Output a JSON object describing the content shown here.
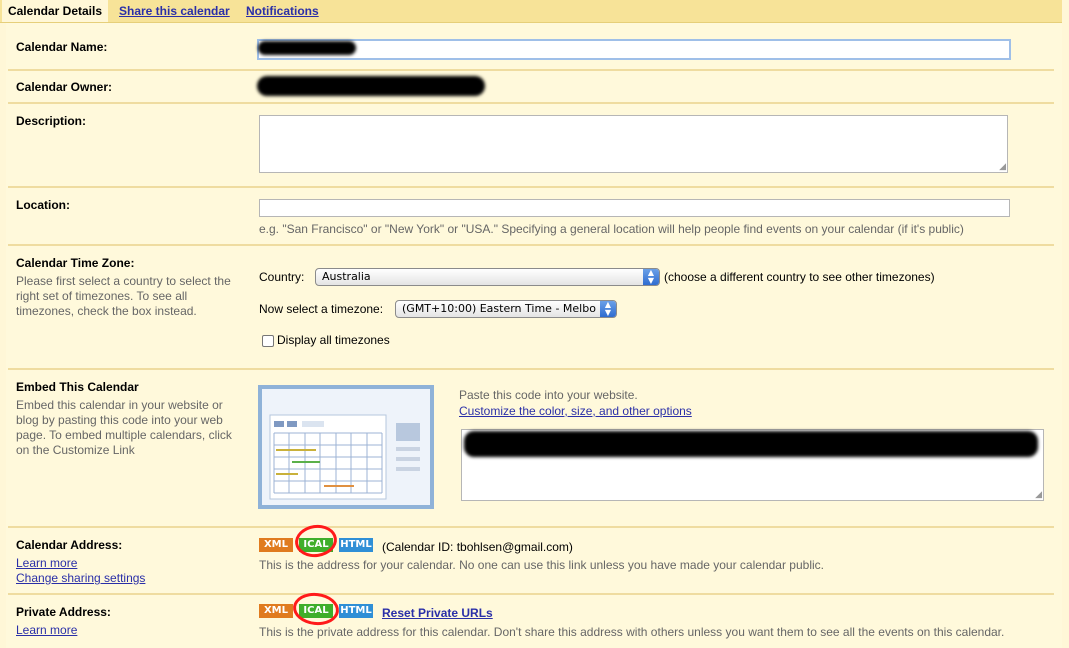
{
  "tabs": {
    "details": "Calendar Details",
    "share": "Share this calendar",
    "notifications": "Notifications"
  },
  "name": {
    "label": "Calendar Name:"
  },
  "owner": {
    "label": "Calendar Owner:"
  },
  "description": {
    "label": "Description:"
  },
  "location": {
    "label": "Location:",
    "hint": "e.g. \"San Francisco\" or \"New York\" or \"USA.\" Specifying a general location will help people find events on your calendar (if it's public)"
  },
  "timezone": {
    "label": "Calendar Time Zone:",
    "help": "Please first select a country to select the right set of timezones. To see all timezones, check the box instead.",
    "country_label": "Country:",
    "country_value": "Australia",
    "country_hint": "(choose a different country to see other timezones)",
    "tz_label": "Now select a timezone:",
    "tz_value": "(GMT+10:00) Eastern Time - Melbo",
    "display_all_label": "Display all timezones"
  },
  "embed": {
    "label": "Embed This Calendar",
    "help": "Embed this calendar in your website or blog by pasting this code into your web page. To embed multiple calendars, click on the Customize Link",
    "paste_text": "Paste this code into your website.",
    "customize_link": "Customize the color, size, and other options"
  },
  "calendar_address": {
    "label": "Calendar Address:",
    "learn_more": "Learn more",
    "change_sharing": "Change sharing settings",
    "xml": "XML",
    "ical": "ICAL",
    "html": "HTML",
    "calendar_id": "(Calendar ID: tbohlsen@gmail.com)",
    "note": "This is the address for your calendar. No one can use this link unless you have made your calendar public."
  },
  "private_address": {
    "label": "Private Address:",
    "learn_more": "Learn more",
    "xml": "XML",
    "ical": "ICAL",
    "html": "HTML",
    "reset_link": "Reset Private URLs",
    "note": "This is the private address for this calendar. Don't share this address with others unless you want them to see all the events on this calendar."
  }
}
